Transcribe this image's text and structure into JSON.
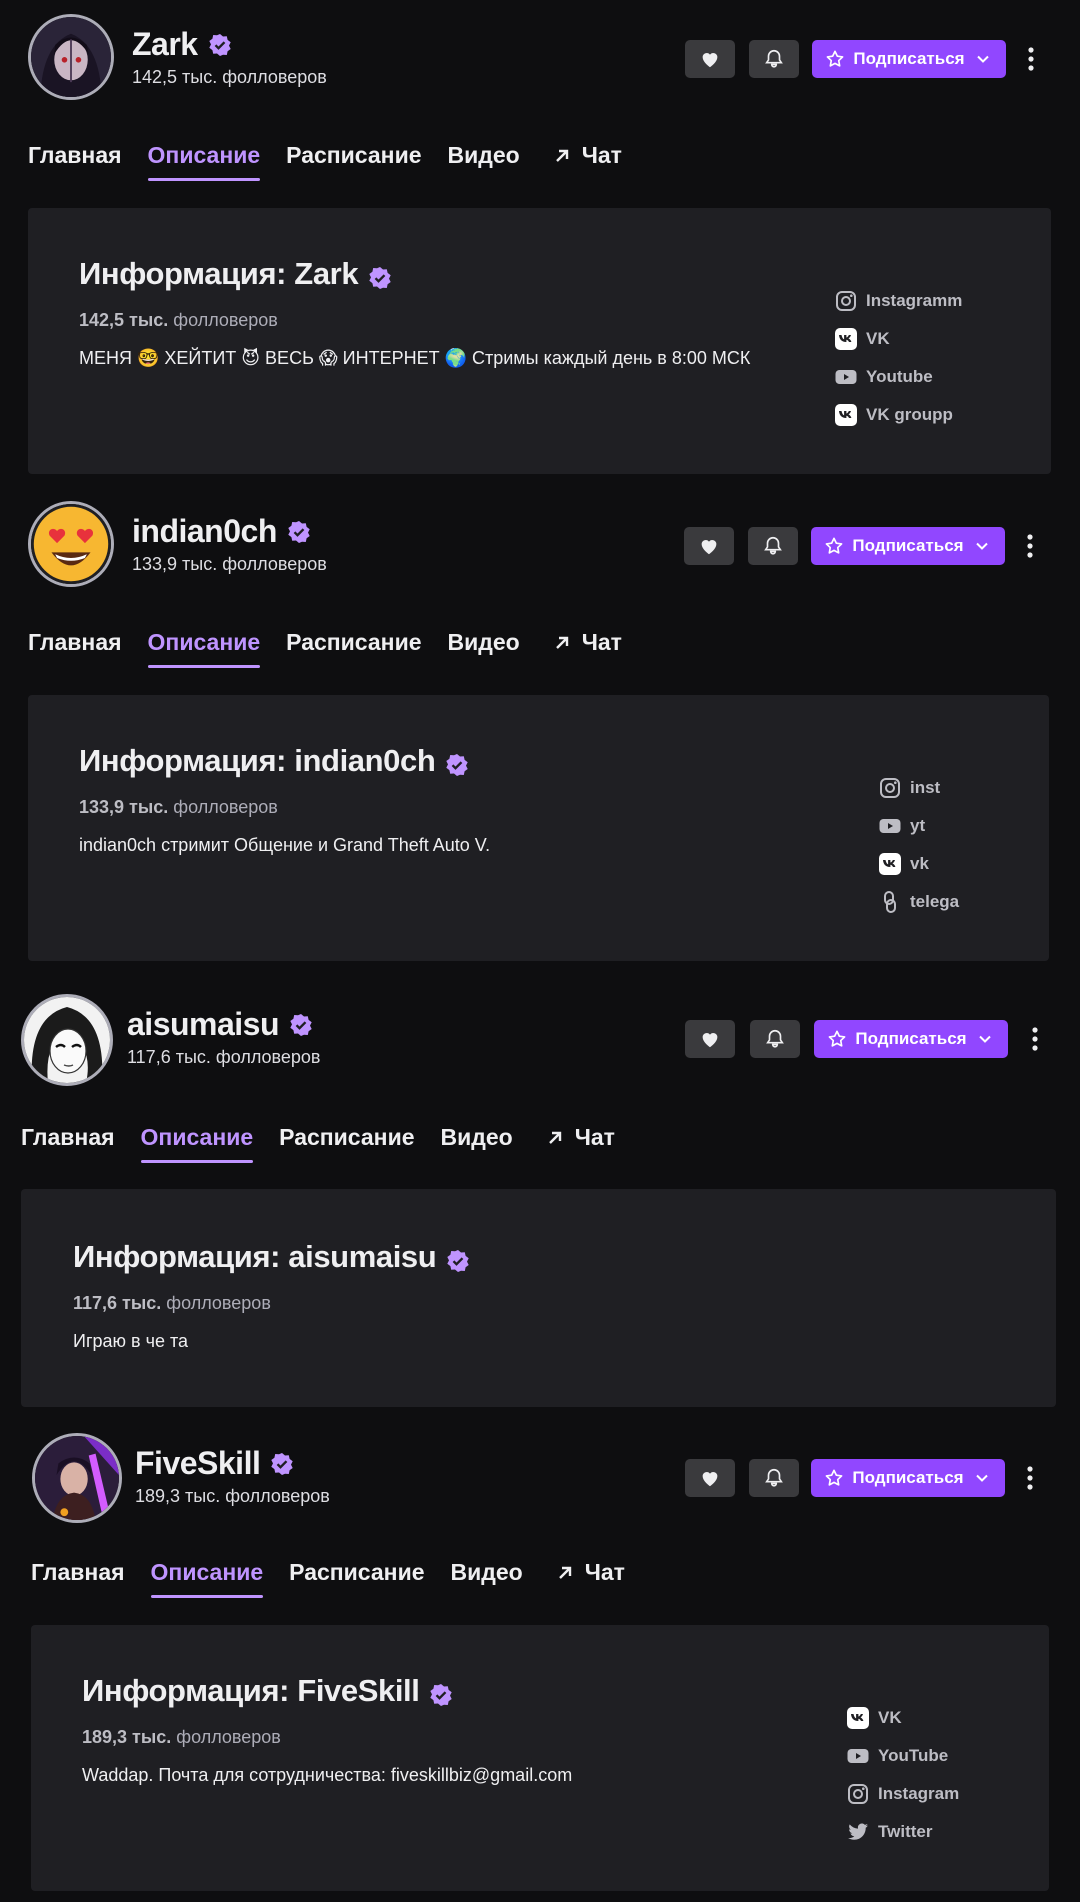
{
  "channels": [
    {
      "name": "Zark",
      "followers": "142,5 тыс. фолловеров",
      "tabs": [
        "Главная",
        "Описание",
        "Расписание",
        "Видео",
        "Чат"
      ],
      "subscribe_label": "Подписаться",
      "info_title": "Информация: Zark",
      "info_followers_count": "142,5 тыс.",
      "info_followers_word": "фолловеров",
      "description": "МЕНЯ 🤓 ХЕЙТИТ 😈 ВЕСЬ 😱 ИНТЕРНЕТ 🌍 Стримы каждый день в 8:00 МСК",
      "links": [
        {
          "label": "Instagramm",
          "icon": "instagram-icon"
        },
        {
          "label": "VK",
          "icon": "vk-icon"
        },
        {
          "label": "Youtube",
          "icon": "youtube-icon"
        },
        {
          "label": "VK groupp",
          "icon": "vk-icon"
        }
      ]
    },
    {
      "name": "indian0ch",
      "followers": "133,9 тыс. фолловеров",
      "tabs": [
        "Главная",
        "Описание",
        "Расписание",
        "Видео",
        "Чат"
      ],
      "subscribe_label": "Подписаться",
      "info_title": "Информация: indian0ch",
      "info_followers_count": "133,9 тыс.",
      "info_followers_word": "фолловеров",
      "description": "indian0ch стримит Общение и Grand Theft Auto V.",
      "links": [
        {
          "label": "inst",
          "icon": "instagram-icon"
        },
        {
          "label": "yt",
          "icon": "youtube-icon"
        },
        {
          "label": "vk",
          "icon": "vk-icon"
        },
        {
          "label": "telega",
          "icon": "link-icon"
        }
      ]
    },
    {
      "name": "aisumaisu",
      "followers": "117,6 тыс. фолловеров",
      "tabs": [
        "Главная",
        "Описание",
        "Расписание",
        "Видео",
        "Чат"
      ],
      "subscribe_label": "Подписаться",
      "info_title": "Информация: aisumaisu",
      "info_followers_count": "117,6 тыс.",
      "info_followers_word": "фолловеров",
      "description": "Играю в че та",
      "links": []
    },
    {
      "name": "FiveSkill",
      "followers": "189,3 тыс. фолловеров",
      "tabs": [
        "Главная",
        "Описание",
        "Расписание",
        "Видео",
        "Чат"
      ],
      "subscribe_label": "Подписаться",
      "info_title": "Информация: FiveSkill",
      "info_followers_count": "189,3 тыс.",
      "info_followers_word": "фолловеров",
      "description": "Waddap. Почта для сотрудничества: fiveskillbiz@gmail.com",
      "links": [
        {
          "label": "VK",
          "icon": "vk-icon"
        },
        {
          "label": "YouTube",
          "icon": "youtube-icon"
        },
        {
          "label": "Instagram",
          "icon": "instagram-icon"
        },
        {
          "label": "Twitter",
          "icon": "twitter-icon"
        }
      ]
    }
  ],
  "colors": {
    "background": "#0e0e10",
    "panel": "#1f1f23",
    "accent": "#9147ff",
    "accent_text": "#bf94ff",
    "button_gray": "#3a3a3d"
  }
}
